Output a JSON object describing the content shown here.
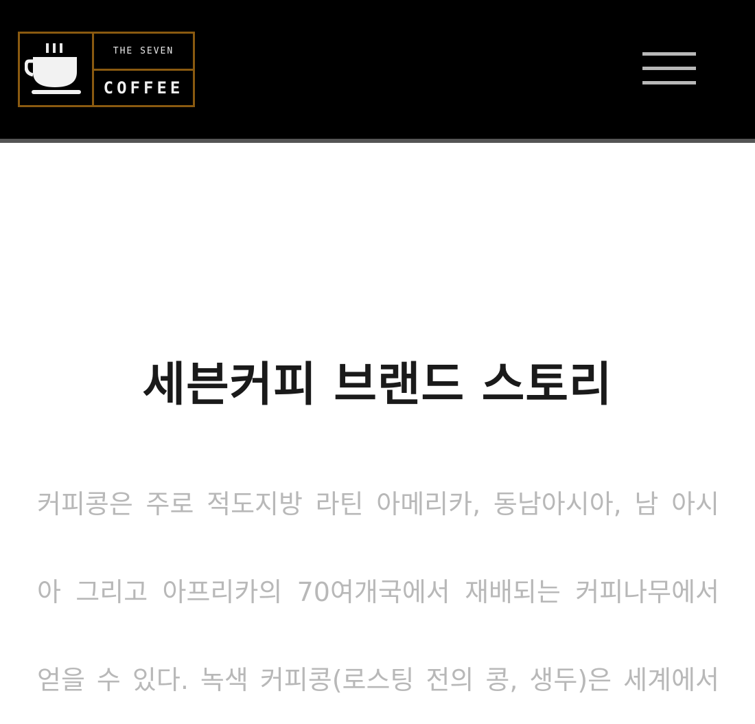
{
  "header": {
    "logo": {
      "tagline": "THE SEVEN",
      "brand": "COFFEE"
    },
    "menu_icon": "hamburger-menu-icon",
    "background_color": "#000000",
    "accent_color": "#8a5a10"
  },
  "main": {
    "title": "세븐커피 브랜드 스토리",
    "story_lines": [
      "커피콩은 주로 적도지방 라틴 아메리카, 동남아시아, 남 아시",
      "아 그리고 아프리카의 70여개국에서 재배되는 커피나무에서",
      "얻을 수 있다. 녹색 커피콩(로스팅 전의 콩, 생두)은 세계에서"
    ]
  }
}
